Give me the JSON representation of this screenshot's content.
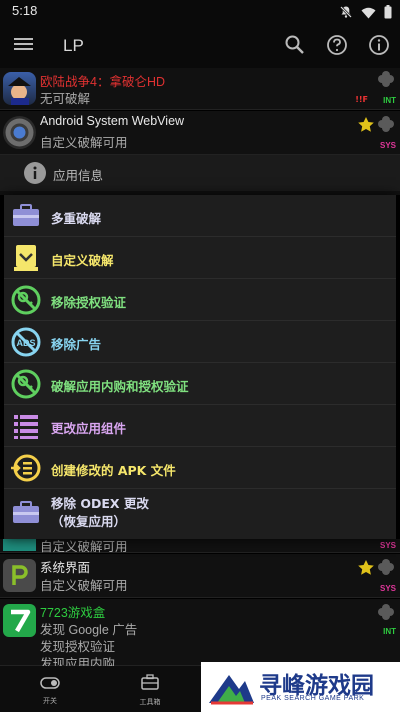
{
  "status": {
    "time": "5:18"
  },
  "appbar": {
    "title": "LP"
  },
  "apps": [
    {
      "name": "欧陆战争4：拿破仑HD",
      "name_color": "#e03131",
      "line1": "无可破解",
      "tag": "INT",
      "tag_color": "#2ecc40",
      "flag": "!!F"
    },
    {
      "name": "Android System WebView",
      "name_color": "#e8e8e8",
      "line1": "自定义破解可用",
      "tag": "SYS",
      "tag_color": "#e0369a"
    },
    {
      "name": "",
      "line1": "自定义破解可用",
      "tag": "SYS",
      "tag_color": "#e0369a"
    },
    {
      "name": "系统界面",
      "name_color": "#e8e8e8",
      "line1": "自定义破解可用",
      "tag": "SYS",
      "tag_color": "#e0369a"
    },
    {
      "name": "7723游戏盒",
      "name_color": "#2ecc40",
      "line1": "发现 Google 广告",
      "line2": "发现授权验证",
      "line3": "发现应用内购",
      "tag": "INT",
      "tag_color": "#2ecc40"
    }
  ],
  "info": {
    "label": "应用信息"
  },
  "menu": [
    {
      "label": "多重破解",
      "color": "#dadaf0",
      "icon": "toolbox-icon"
    },
    {
      "label": "自定义破解",
      "color": "#f5e66b",
      "icon": "custom-patch-icon"
    },
    {
      "label": "移除授权验证",
      "color": "#7fe07f",
      "icon": "no-license-icon"
    },
    {
      "label": "移除广告",
      "color": "#88d4f0",
      "icon": "no-ads-icon"
    },
    {
      "label": "破解应用内购和授权验证",
      "color": "#7fe07f",
      "icon": "no-license-icon"
    },
    {
      "label": "更改应用组件",
      "color": "#d9a6f0",
      "icon": "components-icon"
    },
    {
      "label": "创建修改的 APK 文件",
      "color": "#f5e66b",
      "icon": "create-apk-icon"
    },
    {
      "label": "移除 ODEX 更改",
      "label2": "（恢复应用）",
      "color": "#dadaf0",
      "icon": "toolbox-icon"
    }
  ],
  "bottomnav": {
    "switches": "开关",
    "toolbox": "工具箱"
  },
  "brand": {
    "name": "寻峰游戏园",
    "tagline": "PEAK SEARCH GAME PARK"
  },
  "colors": {
    "accent": "#1e3a8a"
  }
}
